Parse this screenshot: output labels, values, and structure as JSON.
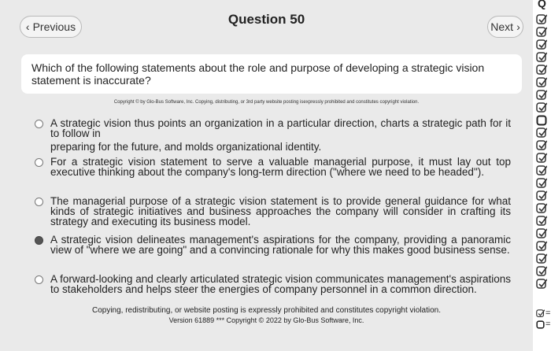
{
  "nav": {
    "previous_label": "Previous",
    "next_label": "Next",
    "previous_icon": "chevron-left-icon",
    "next_icon": "chevron-right-icon"
  },
  "question": {
    "title": "Question 50",
    "text": "Which of the following statements about the role and purpose of developing a strategic vision statement is inaccurate?",
    "copyright_notice": "Copyright © by Glo-Bus Software, Inc. Copying, distributing, or 3rd party website posting isexpressly prohibited and constitutes copyright violation."
  },
  "options": [
    {
      "lines": [
        "A strategic vision thus points an organization in a particular direction, charts a strategic path for it to follow in",
        "preparing for the future, and molds organizational identity."
      ],
      "selected": false
    },
    {
      "lines": [
        "For a strategic vision statement to serve a valuable managerial purpose, it must lay out top executive thinking about the company's long-term direction (\"where we need to be headed\")."
      ],
      "selected": false
    },
    {
      "lines": [
        "The managerial purpose of a strategic vision statement is to provide general guidance for what kinds of strategic initiatives and business approaches the company will consider in crafting its strategy and executing its business model."
      ],
      "selected": false
    },
    {
      "lines": [
        "A strategic vision delineates management's aspirations for the company, providing a panoramic view of \"where we are going\" and a convincing rationale for why this makes good business sense."
      ],
      "selected": true
    },
    {
      "lines": [
        "A forward-looking and clearly articulated strategic vision communicates management's aspirations to stakeholders and helps steer the energies of company personnel in a common direction."
      ],
      "selected": false
    }
  ],
  "footer": {
    "line1": "Copying, redistributing, or website posting is expressly prohibited and constitutes copyright violation.",
    "line2": "Version 61889 *** Copyright © 2022 by Glo-Bus Software, Inc."
  },
  "side_panel": {
    "top_fragment": "Q",
    "legend_answered": "= A",
    "legend_not": "= N",
    "icons": [
      "check-icon",
      "empty-box-icon"
    ]
  }
}
